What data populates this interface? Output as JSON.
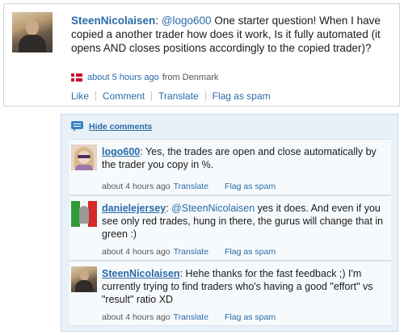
{
  "post": {
    "author": "SteenNicolaisen",
    "separator": ": ",
    "mention": "@logo600",
    "text": " One starter question! When I have copied a another trader how does it work, Is it fully automated (it opens AND closes positions accordingly to the copied trader)?",
    "time": "about 5 hours ago",
    "location": "from Denmark",
    "actions": [
      "Like",
      "Comment",
      "Translate",
      "Flag as spam"
    ]
  },
  "comments_panel": {
    "hide_label": "Hide comments",
    "comments": [
      {
        "author": "logo600",
        "separator": ":",
        "mention": "",
        "text": "  Yes, the trades are open and close automatically by the trader you copy in %.",
        "time": "about 4 hours ago",
        "translate": "Translate",
        "flag": "Flag as spam"
      },
      {
        "author": "danielejersey",
        "separator": ":",
        "mention": "  @SteenNicolaisen",
        "text": " yes it does. And even if you see only red trades, hung in there, the gurus will change that in green :)",
        "time": "about 4 hours ago",
        "translate": "Translate",
        "flag": "Flag as spam"
      },
      {
        "author": "SteenNicolaisen",
        "separator": ":",
        "mention": "",
        "text": "  Hehe thanks for the fast feedback ;) I'm currently trying to find traders who's having a good \"effort\" vs \"result\" ratio XD",
        "time": "about 4 hours ago",
        "translate": "Translate",
        "flag": "Flag as spam"
      }
    ]
  },
  "icons": {
    "post_avatar": "user-avatar",
    "location_flag": "denmark-flag-icon",
    "comments_icon": "speech-bubble-icon"
  },
  "colors": {
    "link": "#2a6aa8",
    "panel_bg": "#e9f1f8",
    "flag_red": "#c8102e"
  }
}
